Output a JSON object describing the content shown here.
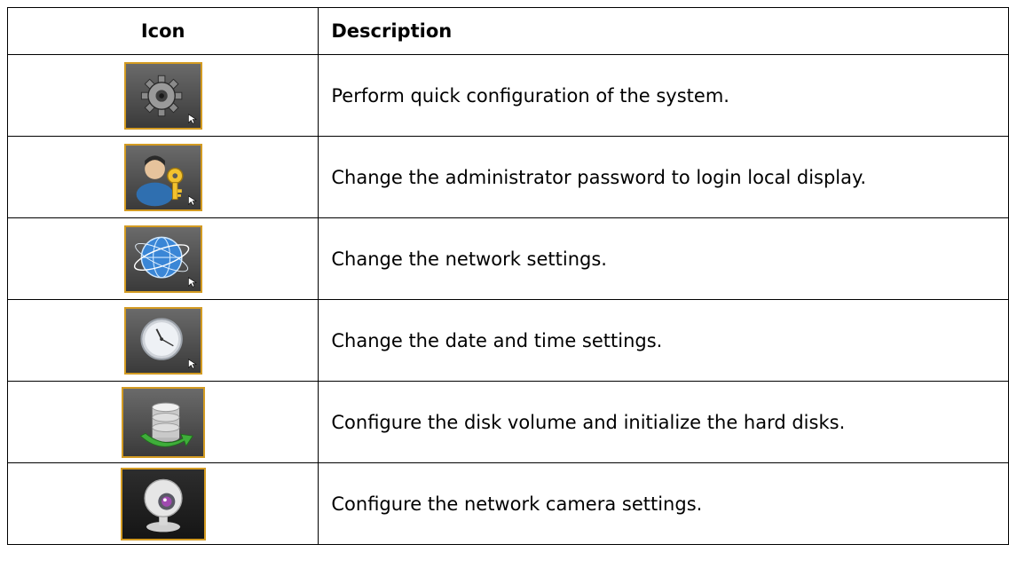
{
  "table": {
    "header": {
      "icon": "Icon",
      "description": "Description"
    },
    "rows": [
      {
        "icon": "gear-icon",
        "description": "Perform quick configuration of the system."
      },
      {
        "icon": "admin-key-icon",
        "description": "Change the administrator password to login local display."
      },
      {
        "icon": "globe-network-icon",
        "description": "Change the network settings."
      },
      {
        "icon": "clock-icon",
        "description": "Change the date and time settings."
      },
      {
        "icon": "disk-volume-icon",
        "description": "Configure the disk volume and initialize the hard disks."
      },
      {
        "icon": "webcam-icon",
        "description": "Configure the network camera settings."
      }
    ]
  },
  "colors": {
    "border": "#000000",
    "icon_frame": "#d39b22"
  }
}
